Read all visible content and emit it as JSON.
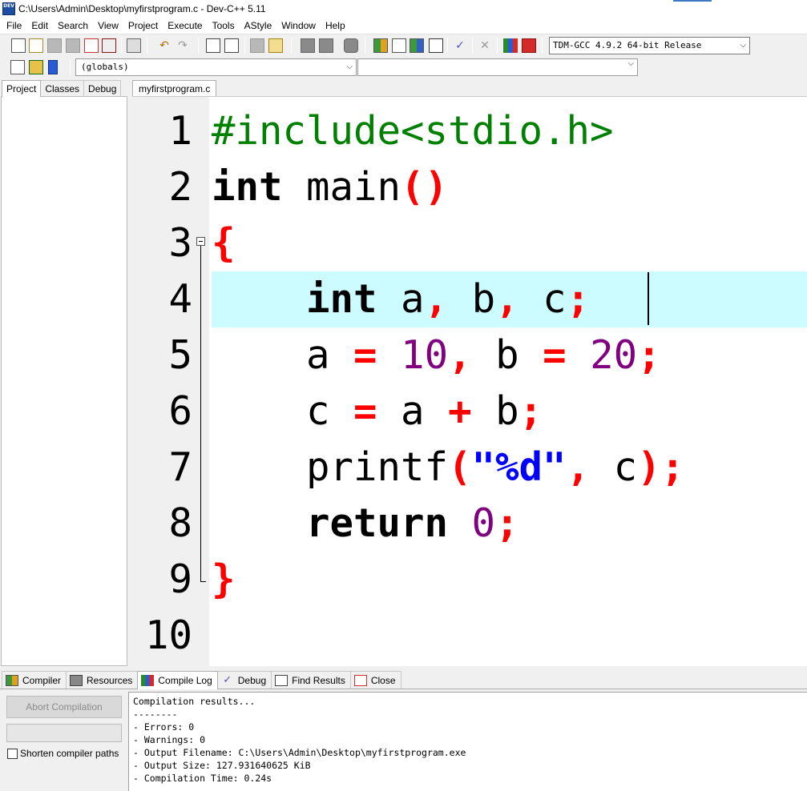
{
  "window": {
    "title": "C:\\Users\\Admin\\Desktop\\myfirstprogram.c - Dev-C++ 5.11",
    "app_icon_label": "DEV"
  },
  "menu": [
    "File",
    "Edit",
    "Search",
    "View",
    "Project",
    "Execute",
    "Tools",
    "AStyle",
    "Window",
    "Help"
  ],
  "toolbar": {
    "compiler_selected": "TDM-GCC 4.9.2 64-bit Release",
    "scope_selected": "(globals)",
    "function_selected": ""
  },
  "left_panel": {
    "tabs": [
      "Project",
      "Classes",
      "Debug"
    ],
    "active_tab": "Project"
  },
  "editor": {
    "tab_label": "myfirstprogram.c",
    "line_numbers": [
      "1",
      "2",
      "3",
      "4",
      "5",
      "6",
      "7",
      "8",
      "9",
      "10"
    ],
    "active_line": 4,
    "lines": {
      "l1": {
        "pre": "#include<stdio.h>"
      },
      "l2": {
        "kw": "int",
        "name": " main",
        "sym": "()"
      },
      "l3": {
        "sym": "{"
      },
      "l4": {
        "indent": "    ",
        "kw": "int",
        "a": " a",
        "c1": ",",
        "b": " b",
        "c2": ",",
        "c": " c",
        "semi": ";"
      },
      "l5": {
        "indent": "    ",
        "a": "a ",
        "eq1": "=",
        "sp1": " ",
        "n1": "10",
        "comma": ",",
        "b": " b ",
        "eq2": "=",
        "sp2": " ",
        "n2": "20",
        "semi": ";"
      },
      "l6": {
        "indent": "    ",
        "c": "c ",
        "eq": "=",
        "a": " a ",
        "plus": "+",
        "b": " b",
        "semi": ";"
      },
      "l7": {
        "indent": "    ",
        "fn": "printf",
        "lp": "(",
        "str": "\"%d\"",
        "comma": ",",
        "c": " c",
        "rp": ")",
        "semi": ";"
      },
      "l8": {
        "indent": "    ",
        "kw": "return",
        "sp": " ",
        "n": "0",
        "semi": ";"
      },
      "l9": {
        "sym": "}"
      }
    }
  },
  "bottom_panel": {
    "tabs": [
      {
        "label": "Compiler",
        "icon": "grid-icon"
      },
      {
        "label": "Resources",
        "icon": "resources-icon"
      },
      {
        "label": "Compile Log",
        "icon": "bar-chart-icon"
      },
      {
        "label": "Debug",
        "icon": "check-icon"
      },
      {
        "label": "Find Results",
        "icon": "find-icon"
      },
      {
        "label": "Close",
        "icon": "close-file-icon"
      }
    ],
    "active_tab": "Compile Log",
    "abort_label": "Abort Compilation",
    "shorten_label": "Shorten compiler paths",
    "shorten_checked": false,
    "log_lines": [
      "Compilation results...",
      "--------",
      "- Errors: 0",
      "- Warnings: 0",
      "- Output Filename: C:\\Users\\Admin\\Desktop\\myfirstprogram.exe",
      "- Output Size: 127.931640625 KiB",
      "- Compilation Time: 0.24s"
    ]
  },
  "colors": {
    "preprocessor": "#008000",
    "symbol": "#ff0000",
    "number": "#800080",
    "string": "#0000ff",
    "active_line": "#ccfcff"
  }
}
